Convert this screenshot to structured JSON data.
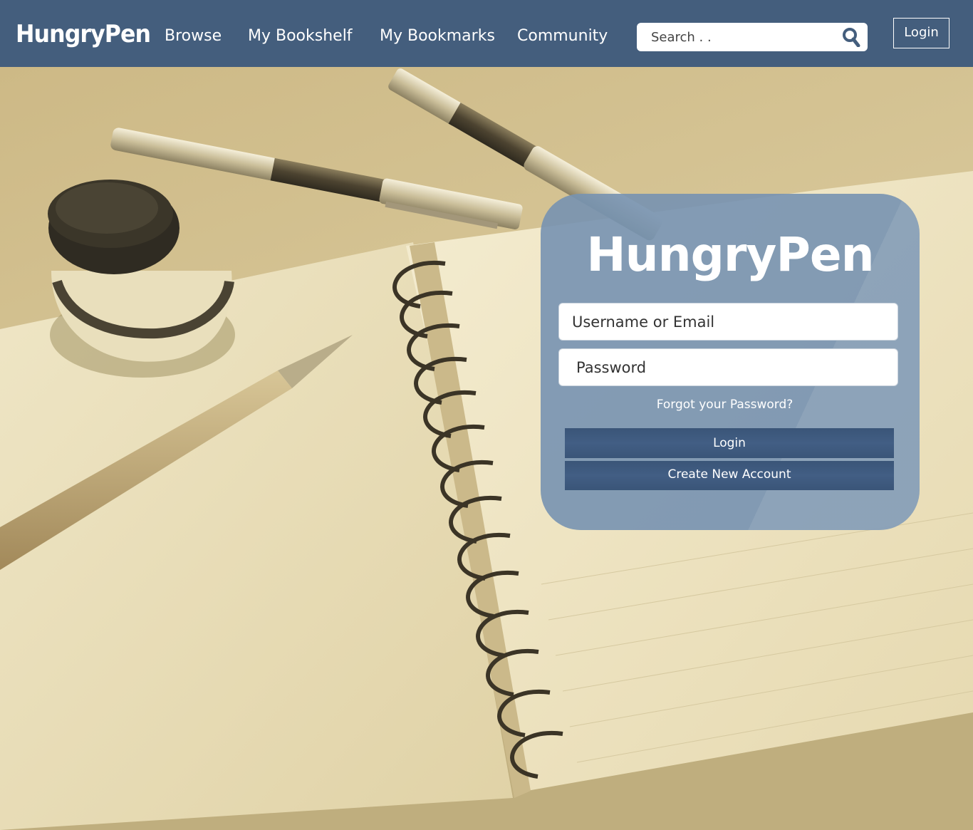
{
  "colors": {
    "nav_bg": "#445e7d",
    "card_bg": "#6e8cac",
    "button_bg": "#3e5a80",
    "text_light": "#ffffff"
  },
  "header": {
    "logo": "HungryPen",
    "nav": [
      "Browse",
      "My Bookshelf",
      "My Bookmarks",
      "Community"
    ],
    "search": {
      "placeholder": "Search . .",
      "icon": "search-icon"
    },
    "login_label": "Login"
  },
  "login_card": {
    "logo": "HungryPen",
    "username_placeholder": "Username or Email",
    "password_placeholder": "Password",
    "forgot_label": "Forgot your Password?",
    "login_label": "Login",
    "create_label": "Create New Account"
  }
}
